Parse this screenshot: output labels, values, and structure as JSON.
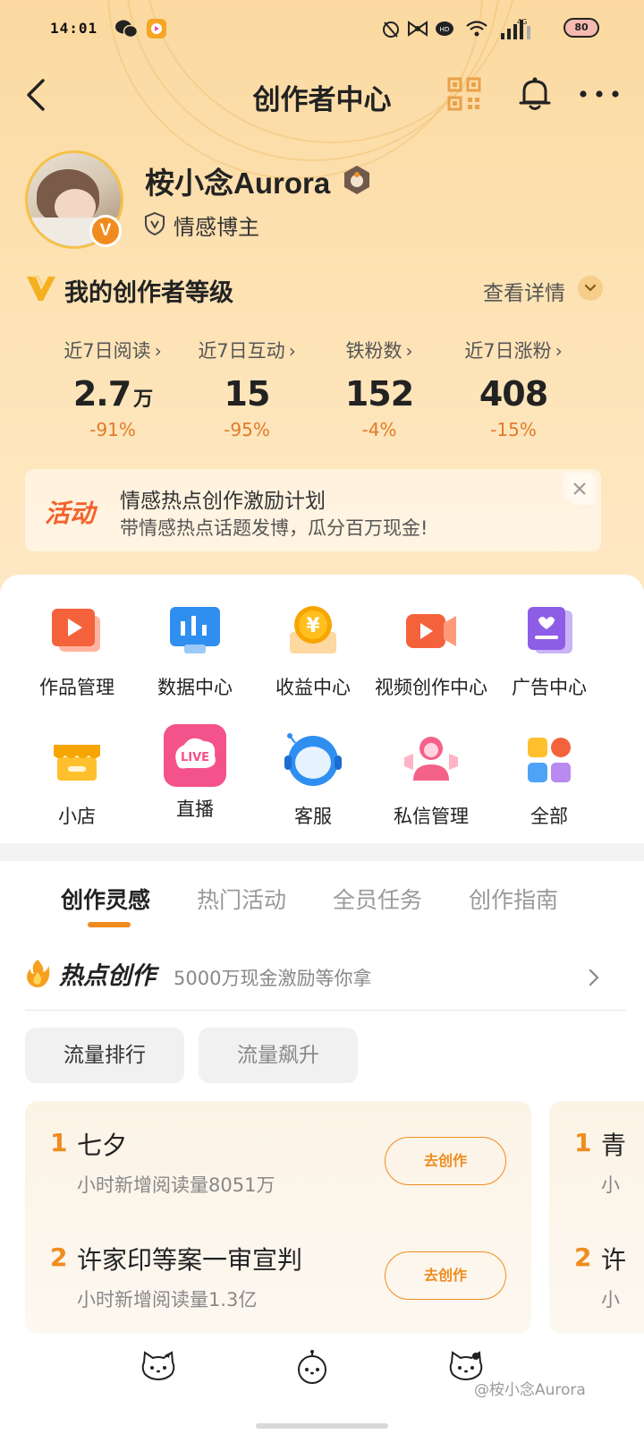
{
  "status_bar": {
    "time": "14:01",
    "icons": [
      "wechat-icon",
      "app-icon",
      "alarm-icon",
      "bow-icon",
      "hd-icon",
      "wifi-icon",
      "signal-icon"
    ],
    "network": "4G",
    "battery": "80"
  },
  "nav": {
    "title": "创作者中心"
  },
  "profile": {
    "name": "桉小念Aurora",
    "role": "情感博主",
    "verified_badge": "V"
  },
  "level": {
    "title": "我的创作者等级",
    "details_link": "查看详情"
  },
  "stats": [
    {
      "label": "近7日阅读",
      "value": "2.7",
      "unit": "万",
      "change": "-91%"
    },
    {
      "label": "近7日互动",
      "value": "15",
      "unit": "",
      "change": "-95%"
    },
    {
      "label": "铁粉数",
      "value": "152",
      "unit": "",
      "change": "-4%"
    },
    {
      "label": "近7日涨粉",
      "value": "408",
      "unit": "",
      "change": "-15%"
    }
  ],
  "banner": {
    "tag": "活动",
    "title": "情感热点创作激励计划",
    "subtitle": "带情感热点话题发博，瓜分百万现金!"
  },
  "grid": [
    {
      "label": "作品管理",
      "icon": "works-icon"
    },
    {
      "label": "数据中心",
      "icon": "data-icon"
    },
    {
      "label": "收益中心",
      "icon": "income-icon"
    },
    {
      "label": "视频创作中心",
      "icon": "video-icon"
    },
    {
      "label": "广告中心",
      "icon": "ads-icon"
    },
    {
      "label": "小店",
      "icon": "shop-icon"
    },
    {
      "label": "直播",
      "icon": "live-icon"
    },
    {
      "label": "客服",
      "icon": "support-icon"
    },
    {
      "label": "私信管理",
      "icon": "messages-icon"
    },
    {
      "label": "全部",
      "icon": "all-icon"
    }
  ],
  "live_icon_text": "LIVE",
  "income_icon_text": "¥",
  "tabs": [
    "创作灵感",
    "热门活动",
    "全员任务",
    "创作指南"
  ],
  "active_tab": 0,
  "hot": {
    "title": "热点创作",
    "subtitle": "5000万现金激励等你拿",
    "chips": [
      "流量排行",
      "流量飙升"
    ],
    "list_left": [
      {
        "rank": "1",
        "title": "七夕",
        "meta": "小时新增阅读量8051万",
        "button": "去创作"
      },
      {
        "rank": "2",
        "title": "许家印等案一审宣判",
        "meta": "小时新增阅读量1.3亿",
        "button": "去创作"
      }
    ],
    "list_right": [
      {
        "rank": "1",
        "title": "青",
        "meta": "小"
      },
      {
        "rank": "2",
        "title": "许",
        "meta": "小"
      }
    ]
  },
  "watermark": "@桉小念Aurora",
  "colors": {
    "accent": "#f08c1e",
    "hero_top": "#fbd9a0",
    "banner_tag": "#f2622b"
  }
}
